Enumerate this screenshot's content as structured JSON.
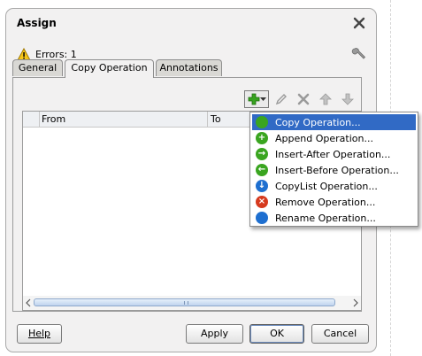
{
  "dialog": {
    "title": "Assign",
    "errors_text": "Errors: 1"
  },
  "tabs": [
    {
      "label": "General",
      "active": false
    },
    {
      "label": "Copy Operation",
      "active": true
    },
    {
      "label": "Annotations",
      "active": false
    }
  ],
  "toolbar": {
    "add_icon": "green-plus-icon",
    "dropdown_icon": "chevron-down-icon",
    "edit_icon": "pencil-icon",
    "delete_icon": "x-icon",
    "up_icon": "arrow-up-icon",
    "down_icon": "arrow-down-icon"
  },
  "table": {
    "columns": [
      "From",
      "To"
    ]
  },
  "menu": {
    "items": [
      {
        "label": "Copy Operation...",
        "icon": "green-circle-icon",
        "color": "#3aa520",
        "glyph": "",
        "selected": true
      },
      {
        "label": "Append Operation...",
        "icon": "plus-circle-icon",
        "color": "#3aa520",
        "glyph": "+",
        "selected": false
      },
      {
        "label": "Insert-After Operation...",
        "icon": "arrow-right-circle-icon",
        "color": "#3aa520",
        "glyph": "→",
        "selected": false
      },
      {
        "label": "Insert-Before Operation...",
        "icon": "arrow-left-circle-icon",
        "color": "#3aa520",
        "glyph": "←",
        "selected": false
      },
      {
        "label": "CopyList Operation...",
        "icon": "arrow-down-circle-icon",
        "color": "#1e6fd0",
        "glyph": "↓",
        "selected": false
      },
      {
        "label": "Remove Operation...",
        "icon": "x-circle-icon",
        "color": "#d63a1e",
        "glyph": "×",
        "selected": false
      },
      {
        "label": "Rename Operation...",
        "icon": "blue-circle-icon",
        "color": "#1e6fd0",
        "glyph": "",
        "selected": false
      }
    ]
  },
  "buttons": {
    "help": "Help",
    "apply": "Apply",
    "ok": "OK",
    "cancel": "Cancel"
  }
}
